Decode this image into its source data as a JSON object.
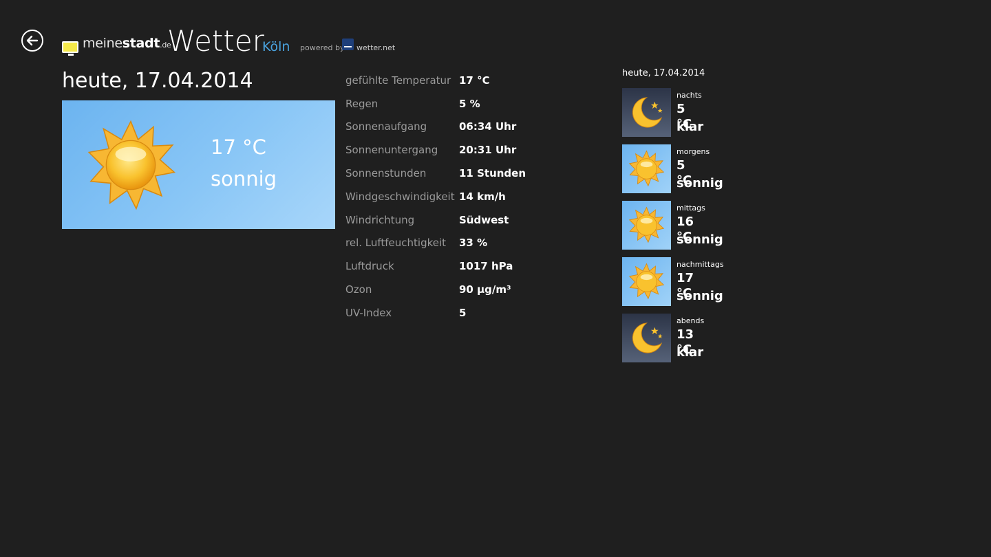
{
  "header": {
    "brand_main": "meine",
    "brand_bold": "stadt",
    "brand_tld": ".de",
    "title": "Wetter",
    "city": "Köln",
    "powered_by": "powered by",
    "provider": "wetter.net"
  },
  "today": {
    "heading": "heute, 17.04.2014",
    "temperature": "17 °C",
    "condition": "sonnig",
    "icon": "sun-icon"
  },
  "details": [
    {
      "label": "gefühlte Temperatur",
      "value": "17 °C"
    },
    {
      "label": "Regen",
      "value": "5 %"
    },
    {
      "label": "Sonnenaufgang",
      "value": "06:34 Uhr"
    },
    {
      "label": "Sonnenuntergang",
      "value": "20:31 Uhr"
    },
    {
      "label": "Sonnenstunden",
      "value": "11 Stunden"
    },
    {
      "label": "Windgeschwindigkeit",
      "value": "14 km/h"
    },
    {
      "label": "Windrichtung",
      "value": "Südwest"
    },
    {
      "label": "rel. Luftfeuchtigkeit",
      "value": "33 %"
    },
    {
      "label": "Luftdruck",
      "value": "1017 hPa"
    },
    {
      "label": "Ozon",
      "value": "90 µg/m³"
    },
    {
      "label": "UV-Index",
      "value": "5"
    }
  ],
  "forecast": {
    "heading": "heute, 17.04.2014",
    "items": [
      {
        "period": "nachts",
        "temperature": "5 °C",
        "condition": "klar",
        "icon": "moon-icon"
      },
      {
        "period": "morgens",
        "temperature": "5 °C",
        "condition": "sonnig",
        "icon": "sun-icon"
      },
      {
        "period": "mittags",
        "temperature": "16 °C",
        "condition": "sonnig",
        "icon": "sun-icon"
      },
      {
        "period": "nachmittags",
        "temperature": "17 °C",
        "condition": "sonnig",
        "icon": "sun-icon"
      },
      {
        "period": "abends",
        "temperature": "13 °C",
        "condition": "klar",
        "icon": "moon-icon"
      }
    ]
  },
  "colors": {
    "background": "#1f1f1f",
    "accent": "#4aa3df",
    "label": "#9a9a9a",
    "sky": "#89c6f6"
  }
}
